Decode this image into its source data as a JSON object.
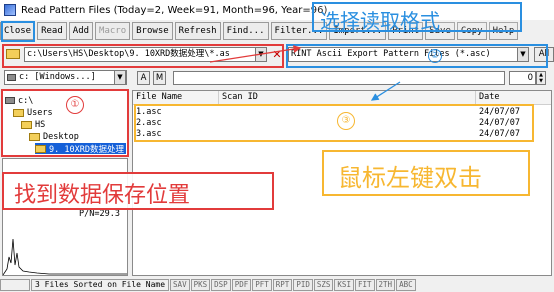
{
  "colors": {
    "annotation_blue": "#2a8fe0",
    "annotation_red": "#e23b3b",
    "annotation_orange": "#f7b731",
    "selection": "#1560d8"
  },
  "window": {
    "title": "Read Pattern Files (Today=2, Week=91, Month=96, Year=96)"
  },
  "toolbar": {
    "buttons": [
      {
        "label": "Close",
        "enabled": true
      },
      {
        "label": "Read",
        "enabled": true
      },
      {
        "label": "Add",
        "enabled": true
      },
      {
        "label": "Macro",
        "enabled": false
      },
      {
        "label": "Browse",
        "enabled": true
      },
      {
        "label": "Refresh",
        "enabled": true
      },
      {
        "label": "Find...",
        "enabled": true
      },
      {
        "label": "Filter...",
        "enabled": true
      },
      {
        "label": "Import...",
        "enabled": true
      },
      {
        "label": "Print",
        "enabled": true
      },
      {
        "label": "Save",
        "enabled": true
      },
      {
        "label": "Copy",
        "enabled": true
      },
      {
        "label": "Help",
        "enabled": true
      }
    ]
  },
  "path": {
    "value": "c:\\Users\\HS\\Desktop\\9. 10XRD数据处理\\*.as",
    "arrow": "▼",
    "close": "✕"
  },
  "filter": {
    "value": "RINT Ascii Export Pattern Files (*.asc)",
    "arrow": "▼",
    "all_label": "All"
  },
  "drive": {
    "value": "c: [Windows...]",
    "arrow": "▼"
  },
  "search": {
    "a_label": "A",
    "m_label": "M",
    "value": "",
    "number": "0"
  },
  "tree": {
    "items": [
      {
        "label": "c:\\",
        "icon": "drive-icon"
      },
      {
        "label": "Users",
        "icon": "folder-open-icon"
      },
      {
        "label": "HS",
        "icon": "folder-open-icon"
      },
      {
        "label": "Desktop",
        "icon": "folder-open-icon"
      },
      {
        "label": "9. 10XRD数据处理",
        "icon": "folder-open-icon",
        "selected": true
      }
    ]
  },
  "preview": {
    "label": "P/N=29.3"
  },
  "file_list": {
    "headers": [
      "File Name",
      "Scan ID",
      "Date"
    ],
    "rows": [
      {
        "name": "1.asc",
        "scan_id": "",
        "date": "24/07/07"
      },
      {
        "name": "2.asc",
        "scan_id": "",
        "date": "24/07/07"
      },
      {
        "name": "3.asc",
        "scan_id": "",
        "date": "24/07/07"
      }
    ]
  },
  "statusbar": {
    "text": "3 Files Sorted on File Name",
    "buttons": [
      "SAV",
      "PKS",
      "DSP",
      "PDF",
      "PFT",
      "RPT",
      "PID",
      "SZS",
      "KSI",
      "FIT",
      "2TH",
      "ABC"
    ]
  },
  "annotations": {
    "circle1": "①",
    "circle2": "②",
    "circle3": "③",
    "select_format": "选择读取格式",
    "find_location": "找到数据保存位置",
    "double_click": "鼠标左键双击"
  }
}
